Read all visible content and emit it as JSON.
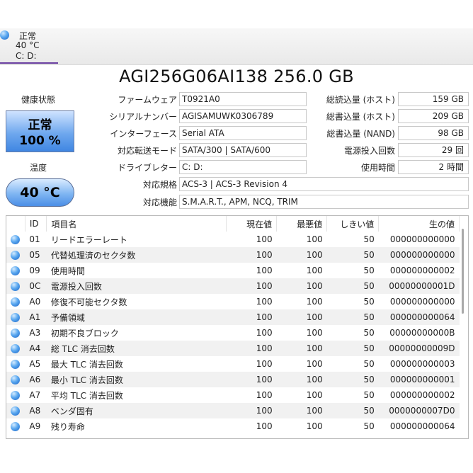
{
  "drive_tab": {
    "status": "正常",
    "temperature": "40 °C",
    "letter": "C: D:"
  },
  "title": "AGI256G06AI138 256.0 GB",
  "health": {
    "label": "健康状態",
    "status": "正常",
    "percent": "100 %"
  },
  "temperature": {
    "label": "温度",
    "value": "40 °C"
  },
  "info_left": [
    {
      "label": "ファームウェア",
      "value": "T0921A0"
    },
    {
      "label": "シリアルナンバー",
      "value": "AGISAMUWK0306789"
    },
    {
      "label": "インターフェース",
      "value": "Serial ATA"
    },
    {
      "label": "対応転送モード",
      "value": "SATA/300 | SATA/600"
    },
    {
      "label": "ドライブレター",
      "value": "C: D:"
    }
  ],
  "info_right": [
    {
      "label": "総読込量 (ホスト)",
      "value": "159 GB"
    },
    {
      "label": "総書込量 (ホスト)",
      "value": "209 GB"
    },
    {
      "label": "総書込量 (NAND)",
      "value": "98 GB"
    },
    {
      "label": "電源投入回数",
      "value": "29 回"
    },
    {
      "label": "使用時間",
      "value": "2 時間"
    }
  ],
  "standard": {
    "label": "対応規格",
    "value": "ACS-3 | ACS-3 Revision 4"
  },
  "features": {
    "label": "対応機能",
    "value": "S.M.A.R.T., APM, NCQ, TRIM"
  },
  "smart": {
    "headers": {
      "id": "ID",
      "name": "項目名",
      "current": "現在値",
      "worst": "最悪値",
      "threshold": "しきい値",
      "raw": "生の値"
    },
    "rows": [
      {
        "id": "01",
        "name": "リードエラーレート",
        "current": "100",
        "worst": "100",
        "threshold": "50",
        "raw": "000000000000"
      },
      {
        "id": "05",
        "name": "代替処理済のセクタ数",
        "current": "100",
        "worst": "100",
        "threshold": "50",
        "raw": "000000000000"
      },
      {
        "id": "09",
        "name": "使用時間",
        "current": "100",
        "worst": "100",
        "threshold": "50",
        "raw": "000000000002"
      },
      {
        "id": "0C",
        "name": "電源投入回数",
        "current": "100",
        "worst": "100",
        "threshold": "50",
        "raw": "00000000001D"
      },
      {
        "id": "A0",
        "name": "修復不可能セクタ数",
        "current": "100",
        "worst": "100",
        "threshold": "50",
        "raw": "000000000000"
      },
      {
        "id": "A1",
        "name": "予備領域",
        "current": "100",
        "worst": "100",
        "threshold": "50",
        "raw": "000000000064"
      },
      {
        "id": "A3",
        "name": "初期不良ブロック",
        "current": "100",
        "worst": "100",
        "threshold": "50",
        "raw": "00000000000B"
      },
      {
        "id": "A4",
        "name": "総 TLC 消去回数",
        "current": "100",
        "worst": "100",
        "threshold": "50",
        "raw": "00000000009D"
      },
      {
        "id": "A5",
        "name": "最大 TLC 消去回数",
        "current": "100",
        "worst": "100",
        "threshold": "50",
        "raw": "000000000003"
      },
      {
        "id": "A6",
        "name": "最小 TLC 消去回数",
        "current": "100",
        "worst": "100",
        "threshold": "50",
        "raw": "000000000001"
      },
      {
        "id": "A7",
        "name": "平均 TLC 消去回数",
        "current": "100",
        "worst": "100",
        "threshold": "50",
        "raw": "000000000002"
      },
      {
        "id": "A8",
        "name": "ベンダ固有",
        "current": "100",
        "worst": "100",
        "threshold": "50",
        "raw": "0000000007D0"
      },
      {
        "id": "A9",
        "name": "残り寿命",
        "current": "100",
        "worst": "100",
        "threshold": "50",
        "raw": "000000000064"
      }
    ]
  }
}
